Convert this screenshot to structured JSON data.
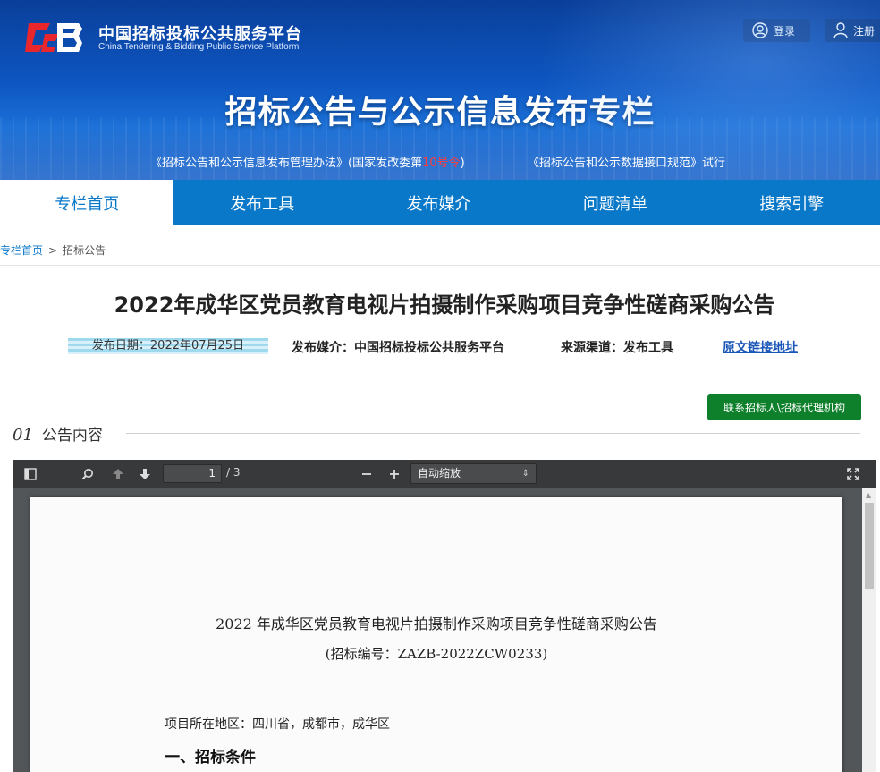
{
  "header": {
    "logo_cn": "中国招标投标公共服务平台",
    "logo_en": "China Tendering & Bidding Public Service Platform",
    "login_label": "登录",
    "register_label": "注册",
    "banner_title": "招标公告与公示信息发布专栏",
    "policy_1_prefix": "《招标公告和公示信息发布管理办法》(国家发改委第",
    "policy_1_number": "10号令",
    "policy_1_suffix": ")",
    "policy_2": "《招标公告和公示数据接口规范》试行"
  },
  "nav": {
    "items": [
      "专栏首页",
      "发布工具",
      "发布媒介",
      "问题清单",
      "搜索引擎"
    ],
    "active_index": 0
  },
  "breadcrumb": {
    "home": "专栏首页",
    "separator": ">",
    "current": "招标公告"
  },
  "article": {
    "title": "2022年成华区党员教育电视片拍摄制作采购项目竞争性磋商采购公告",
    "date": "发布日期：2022年07月25日",
    "media": "发布媒介：中国招标投标公共服务平台",
    "source": "来源渠道：发布工具",
    "link_label": "原文链接地址",
    "contact_button": "联系招标人\\招标代理机构",
    "section_number": "01",
    "section_label": "公告内容"
  },
  "viewer": {
    "current_page": "1",
    "page_count": "/ 3",
    "zoom": "自动缩放",
    "doc_title": "2022 年成华区党员教育电视片拍摄制作采购项目竞争性磋商采购公告",
    "doc_code": "(招标编号：ZAZB-2022ZCW0233)",
    "doc_location": "项目所在地区：四川省，成都市，成华区",
    "doc_heading": "一、招标条件"
  },
  "colors": {
    "nav_blue": "#0a78c9",
    "contact_green": "#0e7f2a",
    "policy_red": "#ff3b3b",
    "link_blue": "#1a56b8"
  }
}
